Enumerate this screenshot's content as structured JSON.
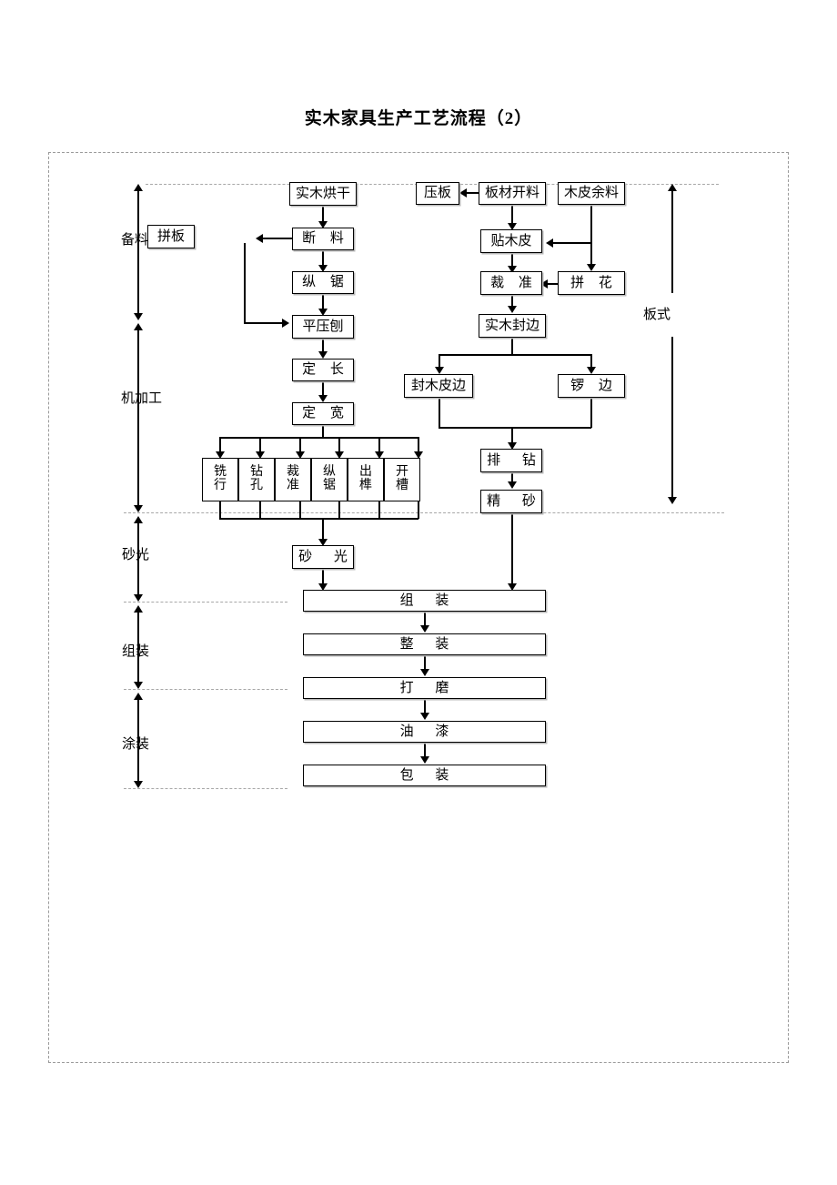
{
  "title": "实木家具生产工艺流程（2）",
  "stage_axis": {
    "label_prep": "备料",
    "label_machining": "机加工",
    "label_sanding": "砂光",
    "label_assembly": "组装",
    "label_finishing": "涂装"
  },
  "side_axis": {
    "label_panel": "板式"
  },
  "solid_wood_line": {
    "dry": "实木烘干",
    "crosscut": "断  料",
    "ripsaw": "纵  锯",
    "planer": "平压刨",
    "length": "定  长",
    "width": "定  宽",
    "glue_up": "拼板"
  },
  "machining_row": [
    {
      "label": "铣行",
      "chars": [
        "铣",
        "行"
      ]
    },
    {
      "label": "钻孔",
      "chars": [
        "钻",
        "孔"
      ]
    },
    {
      "label": "裁准",
      "chars": [
        "裁",
        "准"
      ]
    },
    {
      "label": "纵锯",
      "chars": [
        "纵",
        "锯"
      ]
    },
    {
      "label": "出榫",
      "chars": [
        "出",
        "榫"
      ]
    },
    {
      "label": "开槽",
      "chars": [
        "开",
        "槽"
      ]
    }
  ],
  "panel_line": {
    "press": "压板",
    "cut_panel": "板材开料",
    "veneer_scrap": "木皮余料",
    "veneer_apply": "贴木皮",
    "trim": "裁  准",
    "marquetry": "拼  花",
    "solid_edge": "实木封边",
    "veneer_edge": "封木皮边",
    "router_edge": "锣  边",
    "row_drill": "排  钻",
    "fine_sand": "精  砂"
  },
  "common_line": {
    "sanding": "砂  光",
    "assembly": "组  装",
    "final_assembly": "整  装",
    "polishing": "打  磨",
    "painting": "油  漆",
    "packaging": "包  装"
  },
  "colors": {
    "line": "#000000",
    "box_border": "#000000",
    "box_shadow": "#b8b8b8",
    "frame_dash": "#9a9a9a",
    "separator": "#a7a7a7",
    "background": "#ffffff"
  }
}
